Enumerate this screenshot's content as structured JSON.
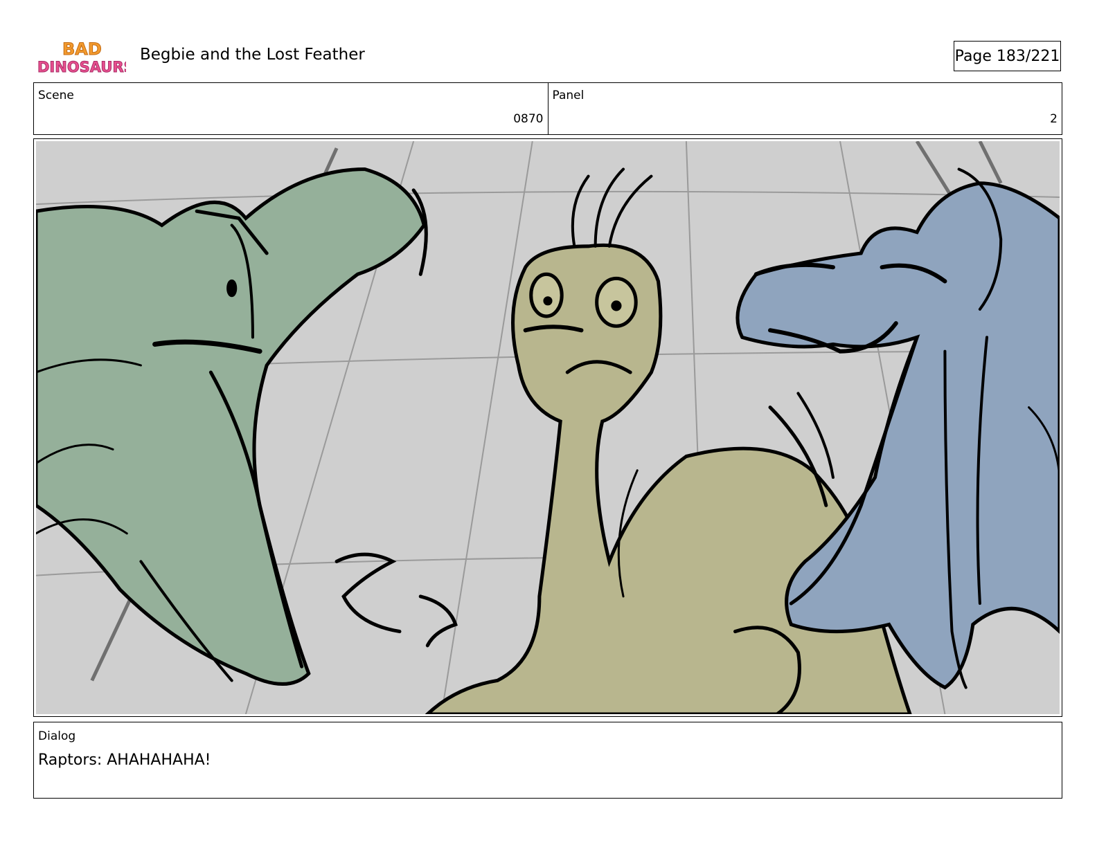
{
  "header": {
    "logo_text": "BAD DINOSAURS",
    "title": "Begbie and the Lost Feather",
    "page": "Page 183/221"
  },
  "meta": {
    "scene_label": "Scene",
    "scene_value": "0870",
    "panel_label": "Panel",
    "panel_value": "2"
  },
  "panel": {
    "characters": [
      "green-raptor",
      "begbie-tan-dinosaur",
      "blue-raptor"
    ],
    "colors": {
      "background": "#cfcfcf",
      "green_raptor": "#95b09a",
      "begbie": "#b8b68e",
      "blue_raptor": "#8fa4be",
      "ink": "#000000"
    }
  },
  "dialog": {
    "label": "Dialog",
    "text": "Raptors: AHAHAHAHA!"
  }
}
